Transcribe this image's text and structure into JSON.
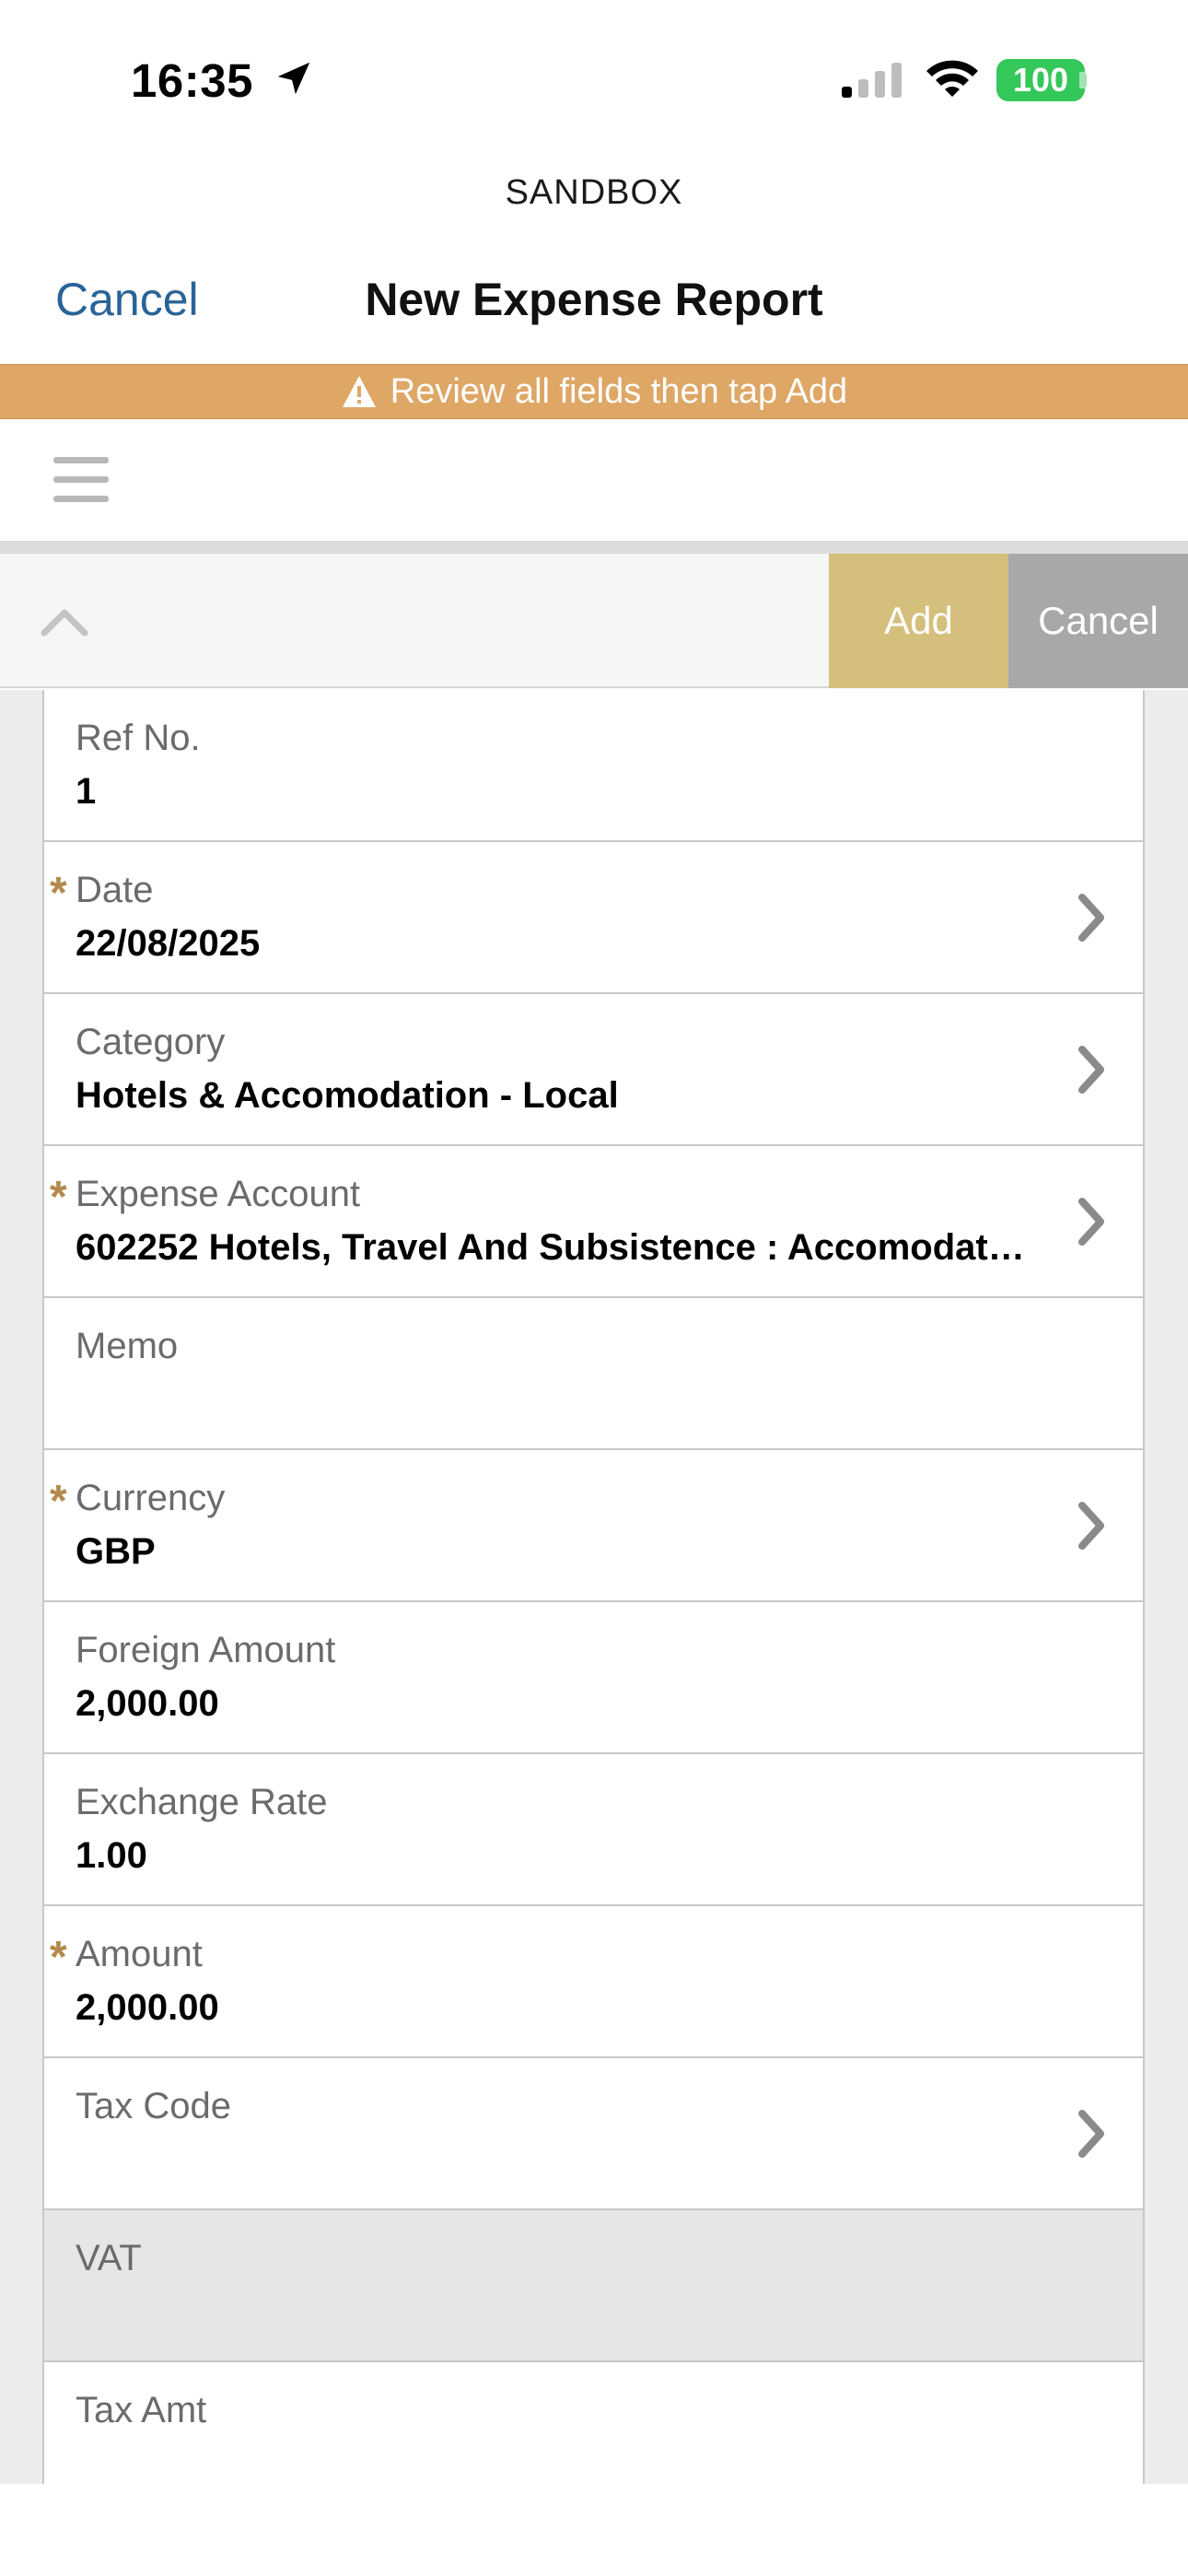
{
  "status_bar": {
    "time": "16:35",
    "battery": "100"
  },
  "environment_label": "SANDBOX",
  "nav": {
    "cancel_label": "Cancel",
    "title": "New Expense Report"
  },
  "banner": {
    "text": "Review all fields then tap Add",
    "color": "#dea766"
  },
  "toolbar": {
    "add_label": "Add",
    "cancel_label": "Cancel",
    "add_color": "#d4bf7c",
    "cancel_color": "#a8a8a8"
  },
  "form": {
    "fields": [
      {
        "label": "Ref No.",
        "value": "1",
        "required": false,
        "has_chevron": false
      },
      {
        "label": "Date",
        "value": "22/08/2025",
        "required": true,
        "has_chevron": true
      },
      {
        "label": "Category",
        "value": "Hotels & Accomodation - Local",
        "required": false,
        "has_chevron": true
      },
      {
        "label": "Expense Account",
        "value": "602252 Hotels, Travel And Subsistence : Accomodat…",
        "required": true,
        "has_chevron": true
      },
      {
        "label": "Memo",
        "value": "",
        "required": false,
        "has_chevron": false
      },
      {
        "label": "Currency",
        "value": "GBP",
        "required": true,
        "has_chevron": true
      },
      {
        "label": "Foreign Amount",
        "value": "2,000.00",
        "required": false,
        "has_chevron": false
      },
      {
        "label": "Exchange Rate",
        "value": "1.00",
        "required": false,
        "has_chevron": false
      },
      {
        "label": "Amount",
        "value": "2,000.00",
        "required": true,
        "has_chevron": false
      },
      {
        "label": "Tax Code",
        "value": "",
        "required": false,
        "has_chevron": true
      },
      {
        "label": "VAT",
        "value": "",
        "required": false,
        "has_chevron": false,
        "disabled": true
      },
      {
        "label": "Tax Amt",
        "value": "",
        "required": false,
        "has_chevron": false
      }
    ]
  },
  "required_marker": "*"
}
